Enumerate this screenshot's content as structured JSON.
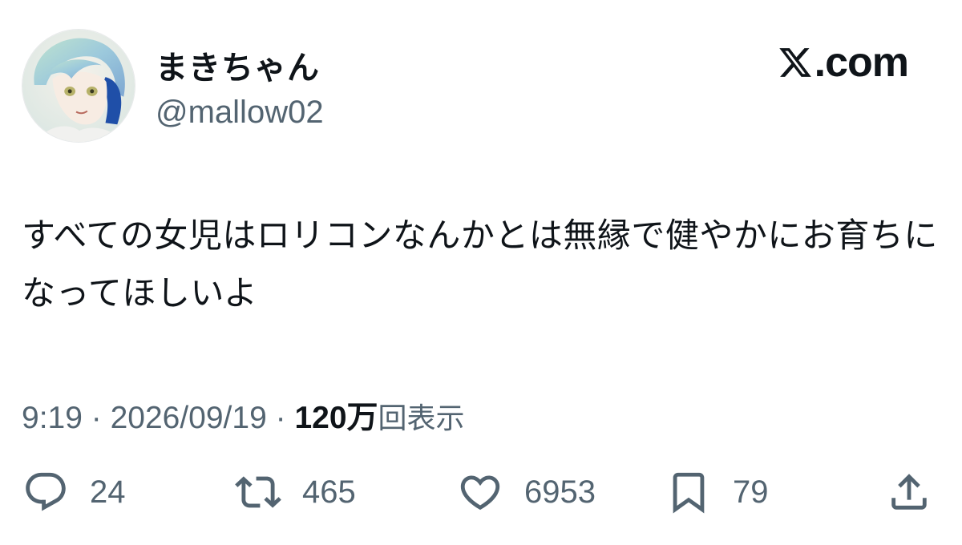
{
  "user": {
    "display_name": "まきちゃん",
    "handle": "@mallow02"
  },
  "brand": {
    "text": ".com"
  },
  "tweet": {
    "text": "すべての女児はロリコンなんかとは無縁で健やかにお育ちになってほしいよ"
  },
  "meta": {
    "time": "9:19",
    "separator": " · ",
    "date": "2026/09/19",
    "views_count": "120万",
    "views_label": "回表示"
  },
  "actions": {
    "replies": "24",
    "reposts": "465",
    "likes": "6953",
    "bookmarks": "79"
  },
  "icons": {
    "reply": "reply-icon",
    "repost": "repost-icon",
    "like": "heart-icon",
    "bookmark": "bookmark-icon",
    "share": "share-icon",
    "brand": "x-logo-icon"
  },
  "colors": {
    "text_primary": "#0f1419",
    "text_secondary": "#536471",
    "background": "#ffffff"
  }
}
